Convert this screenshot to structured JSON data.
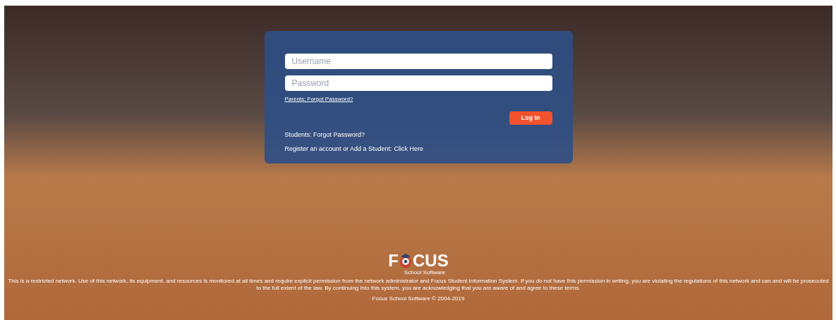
{
  "login": {
    "username": {
      "placeholder": "Username"
    },
    "password": {
      "placeholder": "Password"
    },
    "parents_link": "Parents: Forgot Password?",
    "login_button": "Log In",
    "students_link": "Students: Forgot Password?",
    "register_text": "Register an account or Add a Student:",
    "register_link": "Click Here"
  },
  "logo": {
    "left": "F",
    "right": "CUS",
    "tagline": "School Software"
  },
  "footer": {
    "notice": "This is a restricted network. Use of this network, its equipment, and resources is monitored at all times and require explicit permission from the network administrator and Focus Student Information System. If you do not have this permission in writing, you are violating the regulations of this network and can and will be prosecuted to the full extent of the law. By continuing into this system, you are acknowledging that you are aware of and agree to these terms.",
    "copyright": "Focus School Software © 2004-2019"
  }
}
